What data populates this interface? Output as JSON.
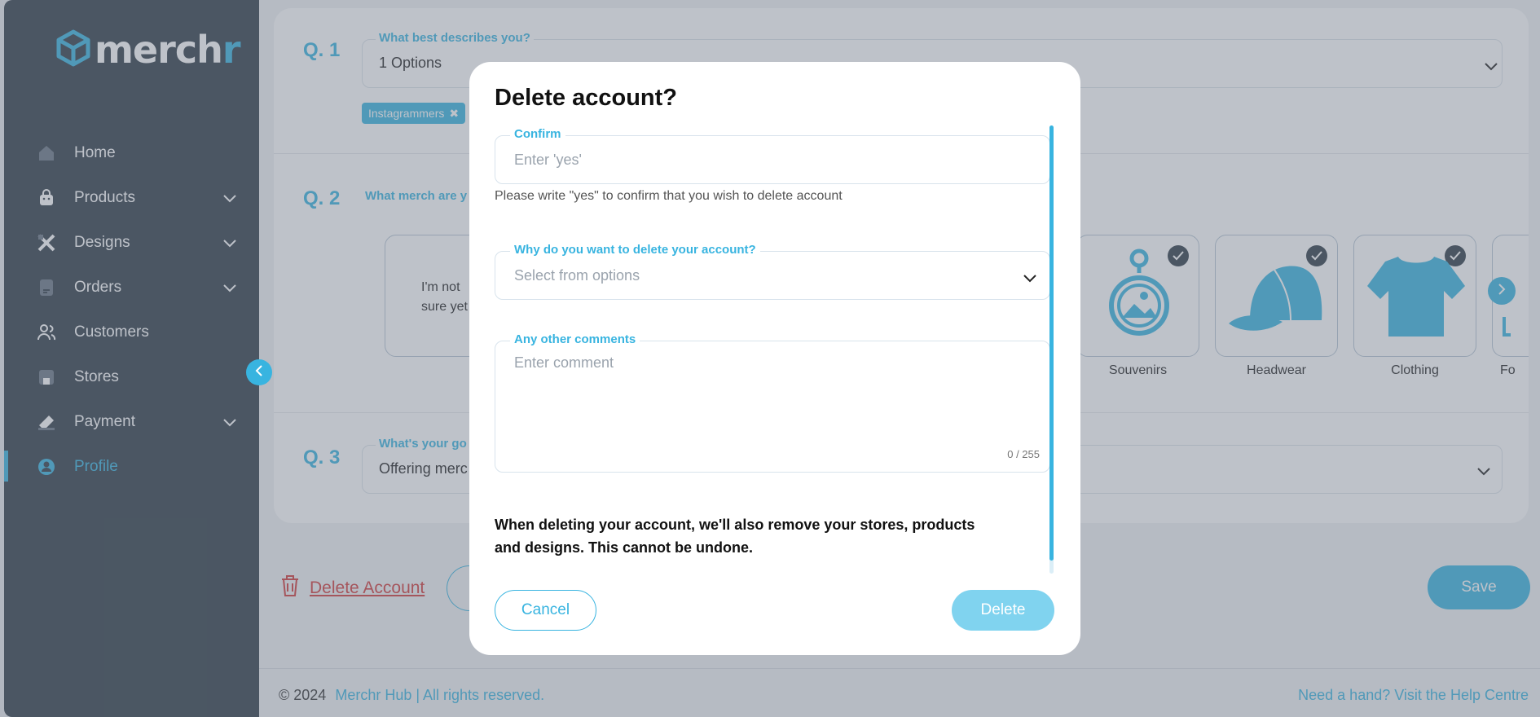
{
  "brand": {
    "name_main": "merch",
    "name_accent": "r",
    "logo_icon": "cube-icon",
    "accent_color": "#38b4e0"
  },
  "sidebar": {
    "items": [
      {
        "label": "Home",
        "icon": "home-icon",
        "has_chevron": false
      },
      {
        "label": "Products",
        "icon": "bag-icon",
        "has_chevron": true
      },
      {
        "label": "Designs",
        "icon": "design-tools-icon",
        "has_chevron": true
      },
      {
        "label": "Orders",
        "icon": "document-icon",
        "has_chevron": true
      },
      {
        "label": "Customers",
        "icon": "users-icon",
        "has_chevron": false
      },
      {
        "label": "Stores",
        "icon": "store-icon",
        "has_chevron": false
      },
      {
        "label": "Payment",
        "icon": "card-icon",
        "has_chevron": true
      },
      {
        "label": "Profile",
        "icon": "user-icon",
        "has_chevron": false,
        "active": true
      }
    ]
  },
  "questions": {
    "q1": {
      "label": "Q. 1",
      "legend": "What best describes you?",
      "value": "1 Options",
      "tag": "Instagrammers"
    },
    "q2": {
      "label": "Q. 2",
      "legend": "What merch are y",
      "unsure": "I'm not sure yet",
      "cards": [
        {
          "label": "Souvenirs",
          "icon": "keychain-icon",
          "checked": true
        },
        {
          "label": "Headwear",
          "icon": "cap-icon",
          "checked": true
        },
        {
          "label": "Clothing",
          "icon": "tshirt-icon",
          "checked": true
        },
        {
          "label": "Fo",
          "icon": "food-icon",
          "checked": false
        }
      ]
    },
    "q3": {
      "label": "Q. 3",
      "legend": "What's your go",
      "value": "Offering merc"
    }
  },
  "actions": {
    "delete_account": "Delete Account",
    "save": "Save"
  },
  "footer": {
    "copyright": "© 2024",
    "company": "Merchr Hub | All rights reserved.",
    "help": "Need a hand? Visit the Help Centre"
  },
  "modal": {
    "title": "Delete account?",
    "confirm": {
      "legend": "Confirm",
      "placeholder": "Enter 'yes'",
      "helper": "Please write \"yes\" to confirm that you wish to delete account"
    },
    "reason": {
      "legend": "Why do you want to delete your account?",
      "placeholder": "Select from options"
    },
    "comments": {
      "legend": "Any other comments",
      "placeholder": "Enter comment",
      "counter": "0 / 255"
    },
    "warning": "When deleting your account, we'll also remove your stores, products and designs. This cannot be undone.",
    "cancel": "Cancel",
    "delete": "Delete"
  }
}
